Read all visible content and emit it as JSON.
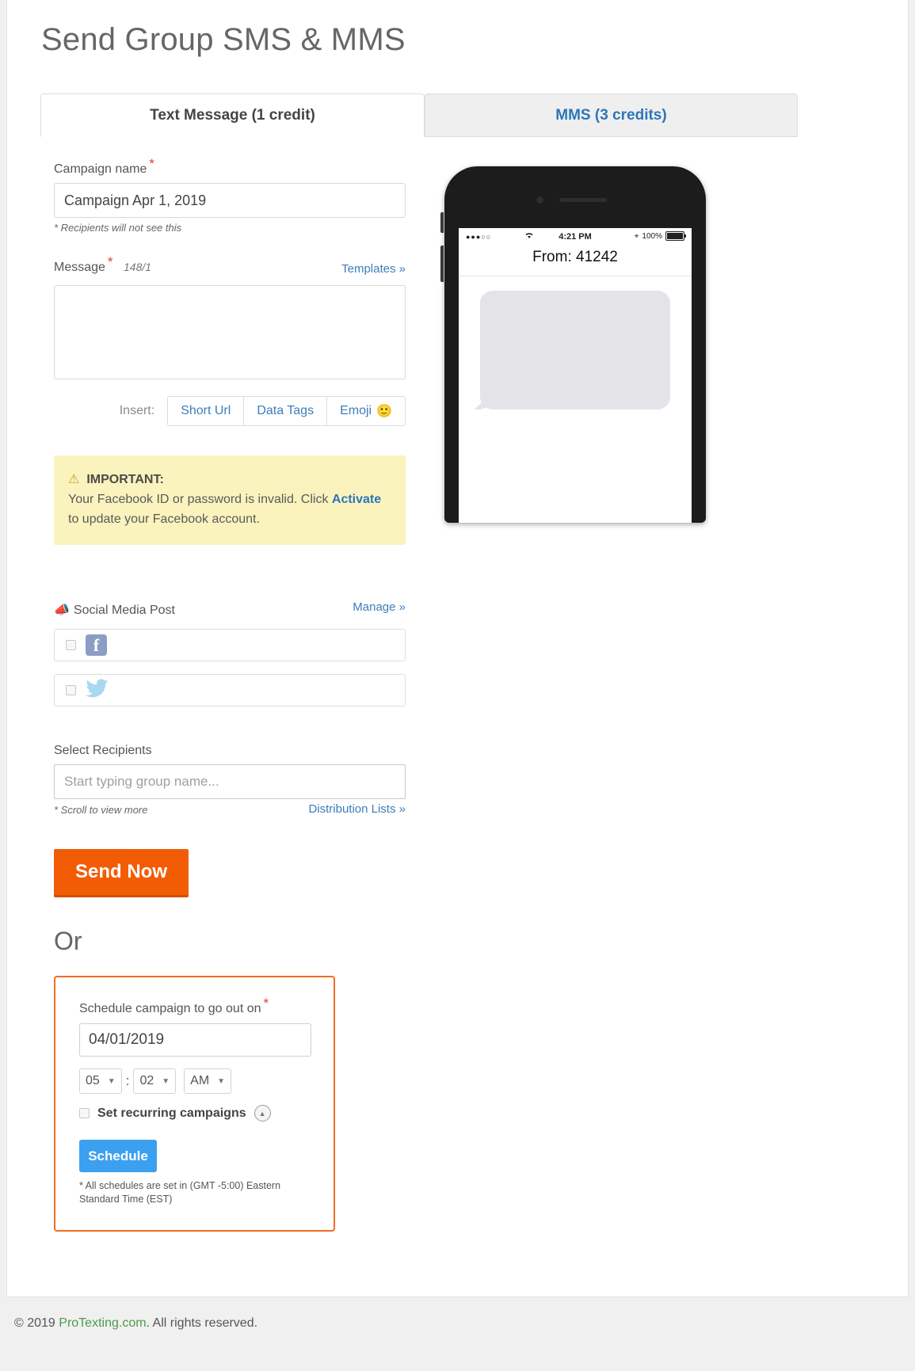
{
  "page_title": "Send Group SMS & MMS",
  "tabs": [
    {
      "label": "Text Message (1 credit)",
      "active": true
    },
    {
      "label": "MMS (3 credits)",
      "active": false
    }
  ],
  "form": {
    "campaign": {
      "label": "Campaign name",
      "required_mark": "*",
      "value": "Campaign Apr 1, 2019",
      "hint": "* Recipients will not see this"
    },
    "message": {
      "label": "Message",
      "required_mark": "*",
      "counter": "148/1",
      "templates_link": "Templates »",
      "value": "",
      "placeholder": ""
    },
    "insert": {
      "label": "Insert:",
      "buttons": [
        {
          "label": "Short Url",
          "icon": ""
        },
        {
          "label": "Data Tags",
          "icon": ""
        },
        {
          "label": "Emoji",
          "icon": "🙂"
        }
      ]
    },
    "alert": {
      "icon": "warning-triangle",
      "title": "IMPORTANT:",
      "text_before": "Your Facebook ID or password is invalid. Click ",
      "link": "Activate",
      "text_after": " to update your Facebook account."
    },
    "social": {
      "title": "Social Media Post",
      "icon": "megaphone-icon",
      "manage_link": "Manage »",
      "networks": [
        {
          "name": "Facebook",
          "icon": "facebook-icon",
          "checked": false
        },
        {
          "name": "Twitter",
          "icon": "twitter-icon",
          "checked": false
        }
      ]
    },
    "recipients": {
      "label": "Select Recipients",
      "value": "",
      "placeholder": "Start typing group name...",
      "hint": "* Scroll to view more",
      "lists_link": "Distribution Lists »"
    },
    "send_button": "Send Now",
    "or_label": "Or",
    "schedule": {
      "label": "Schedule campaign to go out on",
      "required_mark": "*",
      "date": "04/01/2019",
      "hour": "05",
      "minute": "02",
      "meridiem": "AM",
      "separator": ":",
      "recurring_label": "Set recurring campaigns",
      "recurring_checked": false,
      "button": "Schedule",
      "note": "* All schedules are set in (GMT -5:00) Eastern Standard Time (EST)"
    }
  },
  "preview": {
    "status": {
      "signal": "●●●○○",
      "wifi": "wifi-icon",
      "time": "4:21 PM",
      "bluetooth": "bluetooth-icon",
      "battery_pct": "100%"
    },
    "from": "From: 41242",
    "bubble_text": ""
  },
  "footer": {
    "copyright_before": "© 2019 ",
    "brand": "ProTexting.com",
    "copyright_after": ". All rights reserved."
  },
  "colors": {
    "accent_orange": "#f25c05",
    "link_blue": "#3d7eba",
    "schedule_blue": "#3ca0f0",
    "alert_yellow": "#faf3bd",
    "brand_green": "#4b9b4b"
  }
}
